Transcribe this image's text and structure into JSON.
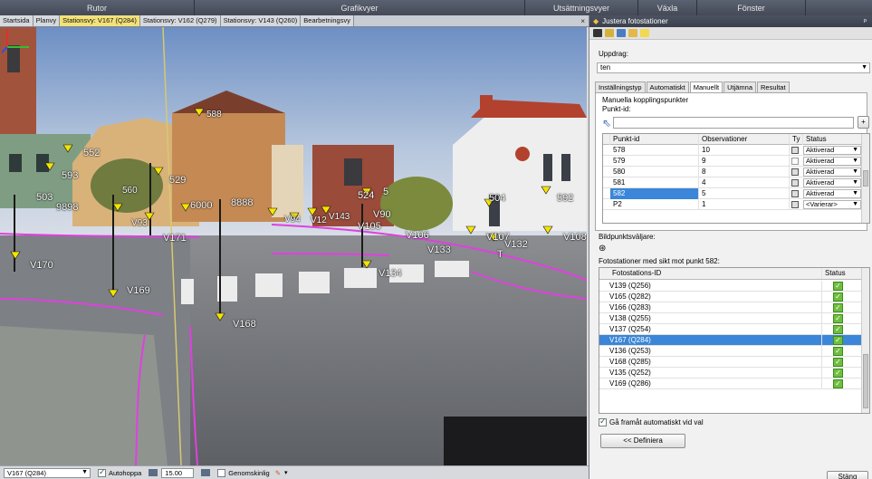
{
  "menubar": {
    "groups": [
      {
        "label": "Rutor"
      },
      {
        "label": "Grafikvyer"
      },
      {
        "label": "Utsättningsvyer"
      },
      {
        "label": "Växla"
      },
      {
        "label": "Fönster"
      }
    ]
  },
  "doc_tabs": [
    {
      "label": "Startsida"
    },
    {
      "label": "Planvy"
    },
    {
      "label": "Stationsvy: V167 (Q284)"
    },
    {
      "label": "Stationsvy: V162 (Q279)"
    },
    {
      "label": "Stationsvy: V143 (Q260)"
    },
    {
      "label": "Bearbetningsvy"
    }
  ],
  "doc_close": "×",
  "viewport": {
    "point_labels": [
      "552",
      "9898",
      "503",
      "593",
      "560",
      "529",
      "588",
      "8888",
      "6000",
      "524",
      "5",
      "V90",
      "504",
      "592",
      "V105",
      "V106",
      "V133",
      "V107",
      "V132",
      "T",
      "V108",
      "V171",
      "V170",
      "V169",
      "V134",
      "V168",
      "V94",
      "V12",
      "V143",
      "V93"
    ]
  },
  "bottombar": {
    "station_select": "V167 (Q284)",
    "autohoppa_label": "Autohoppa",
    "autohoppa_checked": true,
    "value": "15.00",
    "genomskinlig_label": "Genomskinlig",
    "genomskinlig_checked": false,
    "close_label": "Stäng"
  },
  "panel": {
    "title": "Justera fotostationer",
    "pin": "ᵖ",
    "uppdrag_label": "Uppdrag:",
    "uppdrag_value": "ten",
    "tabs": [
      {
        "label": "Inställningstyp"
      },
      {
        "label": "Automatiskt"
      },
      {
        "label": "Manuellt"
      },
      {
        "label": "Utjämna"
      },
      {
        "label": "Resultat"
      }
    ],
    "manual_header": "Manuella kopplingspunkter",
    "punkt_id_label": "Punkt-id:",
    "punkt_id_value": "",
    "add_button": "+",
    "points_columns": {
      "id": "Punkt-id",
      "obs": "Observationer",
      "ty": "Ty",
      "status": "Status"
    },
    "points_rows": [
      {
        "id": "578",
        "obs": "10",
        "status": "Aktiverad"
      },
      {
        "id": "579",
        "obs": "9",
        "status": "Aktiverad"
      },
      {
        "id": "580",
        "obs": "8",
        "status": "Aktiverad"
      },
      {
        "id": "581",
        "obs": "4",
        "status": "Aktiverad"
      },
      {
        "id": "582",
        "obs": "5",
        "status": "Aktiverad"
      },
      {
        "id": "P2",
        "obs": "1",
        "status": "<Varierar>"
      }
    ],
    "bildpunkt_label": "Bildpunktsväljare:",
    "stations_header": "Fotostationer med sikt mot punkt 582:",
    "stations_columns": {
      "id": "Fotostations-ID",
      "status": "Status"
    },
    "stations_rows": [
      {
        "id": "V139 (Q256)"
      },
      {
        "id": "V165 (Q282)"
      },
      {
        "id": "V166 (Q283)"
      },
      {
        "id": "V138 (Q255)"
      },
      {
        "id": "V137 (Q254)"
      },
      {
        "id": "V167 (Q284)"
      },
      {
        "id": "V136 (Q253)"
      },
      {
        "id": "V168 (Q285)"
      },
      {
        "id": "V135 (Q252)"
      },
      {
        "id": "V169 (Q286)"
      }
    ],
    "auto_forward_label": "Gå framåt automatiskt vid val",
    "auto_forward_checked": true,
    "define_button": "<< Definiera"
  },
  "colors": {
    "accent_selection": "#3b86d8",
    "active_tab": "#f3e27a",
    "overlay_magenta": "#e040e0",
    "marker_yellow": "#f5e400"
  }
}
